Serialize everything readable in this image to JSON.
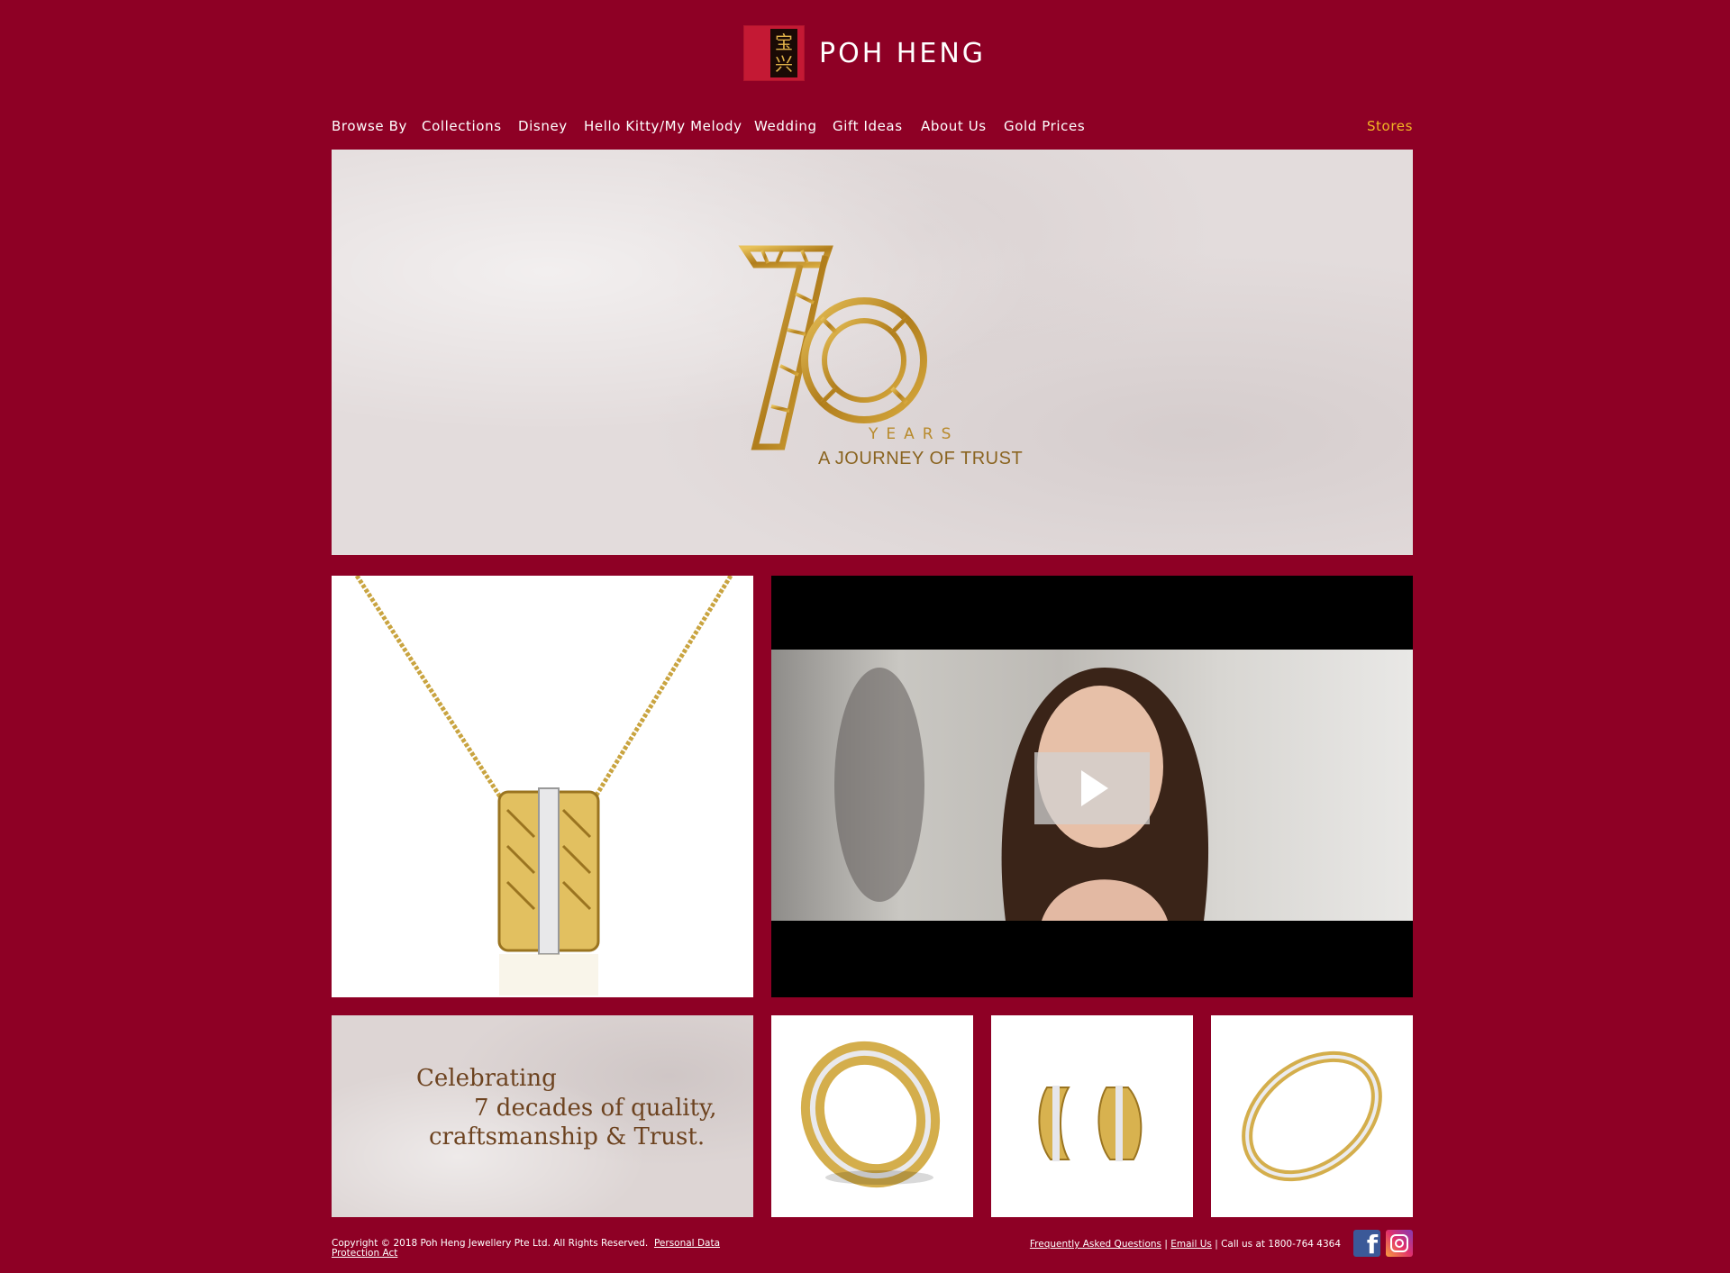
{
  "brand": {
    "name": "POH HENG",
    "logo_chars": [
      "宝",
      "兴"
    ]
  },
  "nav": {
    "items": [
      {
        "label": "Browse By"
      },
      {
        "label": "Collections"
      },
      {
        "label": "Disney"
      },
      {
        "label": "Hello Kitty/My Melody"
      },
      {
        "label": "Wedding"
      },
      {
        "label": "Gift Ideas"
      },
      {
        "label": "About Us"
      },
      {
        "label": "Gold Prices"
      }
    ],
    "stores_label": "Stores"
  },
  "hero": {
    "number": "70",
    "years": "YEARS",
    "tagline": "A JOURNEY OF TRUST"
  },
  "celebrate": {
    "line1": "Celebrating",
    "line2": "7 decades of quality,",
    "line3": "craftsmanship & Trust."
  },
  "footer": {
    "copyright": "Copyright © 2018 Poh Heng Jewellery Pte Ltd. All Rights Reserved.",
    "privacy_link": "Personal Data Protection Act",
    "faq_link": "Frequently Asked Questions",
    "separator": "|",
    "email_link": "Email Us",
    "call_text": "Call us at 1800-764 4364"
  },
  "colors": {
    "background": "#8e0025",
    "stores_accent": "#f2b824",
    "gold": "#b88a2c"
  },
  "icons": {
    "facebook": "facebook-icon",
    "instagram": "instagram-icon",
    "play": "play-icon"
  }
}
